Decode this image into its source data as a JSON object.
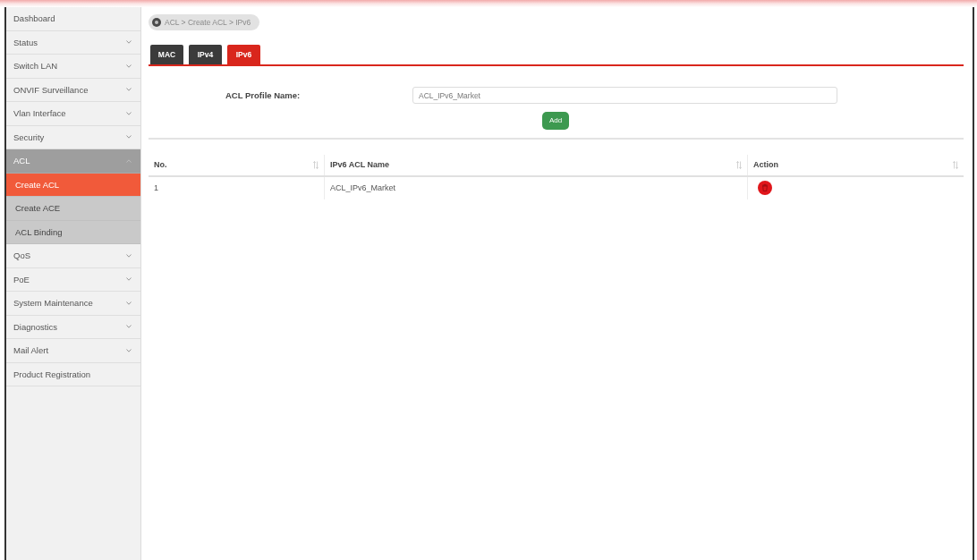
{
  "sidebar": {
    "items": [
      {
        "label": "Dashboard"
      },
      {
        "label": "Status",
        "expanded": false
      },
      {
        "label": "Switch LAN",
        "expanded": false
      },
      {
        "label": "ONVIF Surveillance",
        "expanded": false
      },
      {
        "label": "Vlan Interface",
        "expanded": false
      },
      {
        "label": "Security",
        "expanded": false
      },
      {
        "label": "ACL",
        "expanded": true,
        "children": [
          {
            "label": "Create ACL",
            "selected": true
          },
          {
            "label": "Create ACE",
            "selected": false
          },
          {
            "label": "ACL Binding",
            "selected": false
          }
        ]
      },
      {
        "label": "QoS",
        "expanded": false
      },
      {
        "label": "PoE",
        "expanded": false
      },
      {
        "label": "System Maintenance",
        "expanded": false
      },
      {
        "label": "Diagnostics",
        "expanded": false
      },
      {
        "label": "Mail Alert",
        "expanded": false
      },
      {
        "label": "Product Registration"
      }
    ]
  },
  "breadcrumb": {
    "text": "ACL > Create ACL > IPv6"
  },
  "tabs": [
    {
      "label": "MAC",
      "selected": false
    },
    {
      "label": "IPv4",
      "selected": false
    },
    {
      "label": "IPv6",
      "selected": true
    }
  ],
  "form": {
    "label": "ACL Profile Name:",
    "value": "ACL_IPv6_Market",
    "button": "Add"
  },
  "table": {
    "columns": [
      {
        "label": "No."
      },
      {
        "label": "IPv6 ACL Name"
      },
      {
        "label": "Action"
      }
    ],
    "rows": [
      {
        "no": "1",
        "name": "ACL_IPv6_Market",
        "actions": [
          {
            "kind": "delete"
          }
        ]
      }
    ]
  }
}
